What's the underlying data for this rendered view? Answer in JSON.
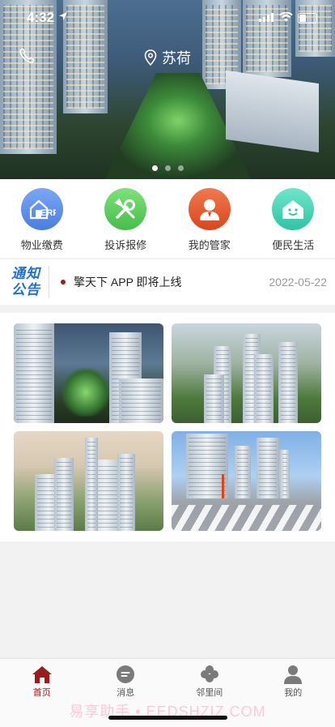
{
  "status_bar": {
    "time": "4:32"
  },
  "header": {
    "location": "苏荷"
  },
  "banner": {
    "slide_count": 3,
    "active_index": 0
  },
  "shortcuts": [
    {
      "label": "物业缴费",
      "icon": "erp-house-icon",
      "color": "#5b8fe8"
    },
    {
      "label": "投诉报修",
      "icon": "wrench-screwdriver-icon",
      "color": "#56cf5c"
    },
    {
      "label": "我的管家",
      "icon": "butler-person-icon",
      "color": "#e85a2e"
    },
    {
      "label": "便民生活",
      "icon": "smiley-house-icon",
      "color": "#3ed2b2"
    }
  ],
  "notice": {
    "logo_line1": "通知",
    "logo_line2": "公告",
    "text": "擎天下 APP 即将上线",
    "date": "2022-05-22"
  },
  "gallery": {
    "photo_count": 4
  },
  "tabs": [
    {
      "label": "首页",
      "icon": "home-icon",
      "active": true
    },
    {
      "label": "消息",
      "icon": "message-icon",
      "active": false
    },
    {
      "label": "邻里间",
      "icon": "clover-icon",
      "active": false
    },
    {
      "label": "我的",
      "icon": "user-icon",
      "active": false
    }
  ],
  "watermark": "易享助手 • EEDSHZIZ.COM",
  "colors": {
    "accent": "#9b1c1c",
    "notice_logo": "#1f6fd6"
  }
}
